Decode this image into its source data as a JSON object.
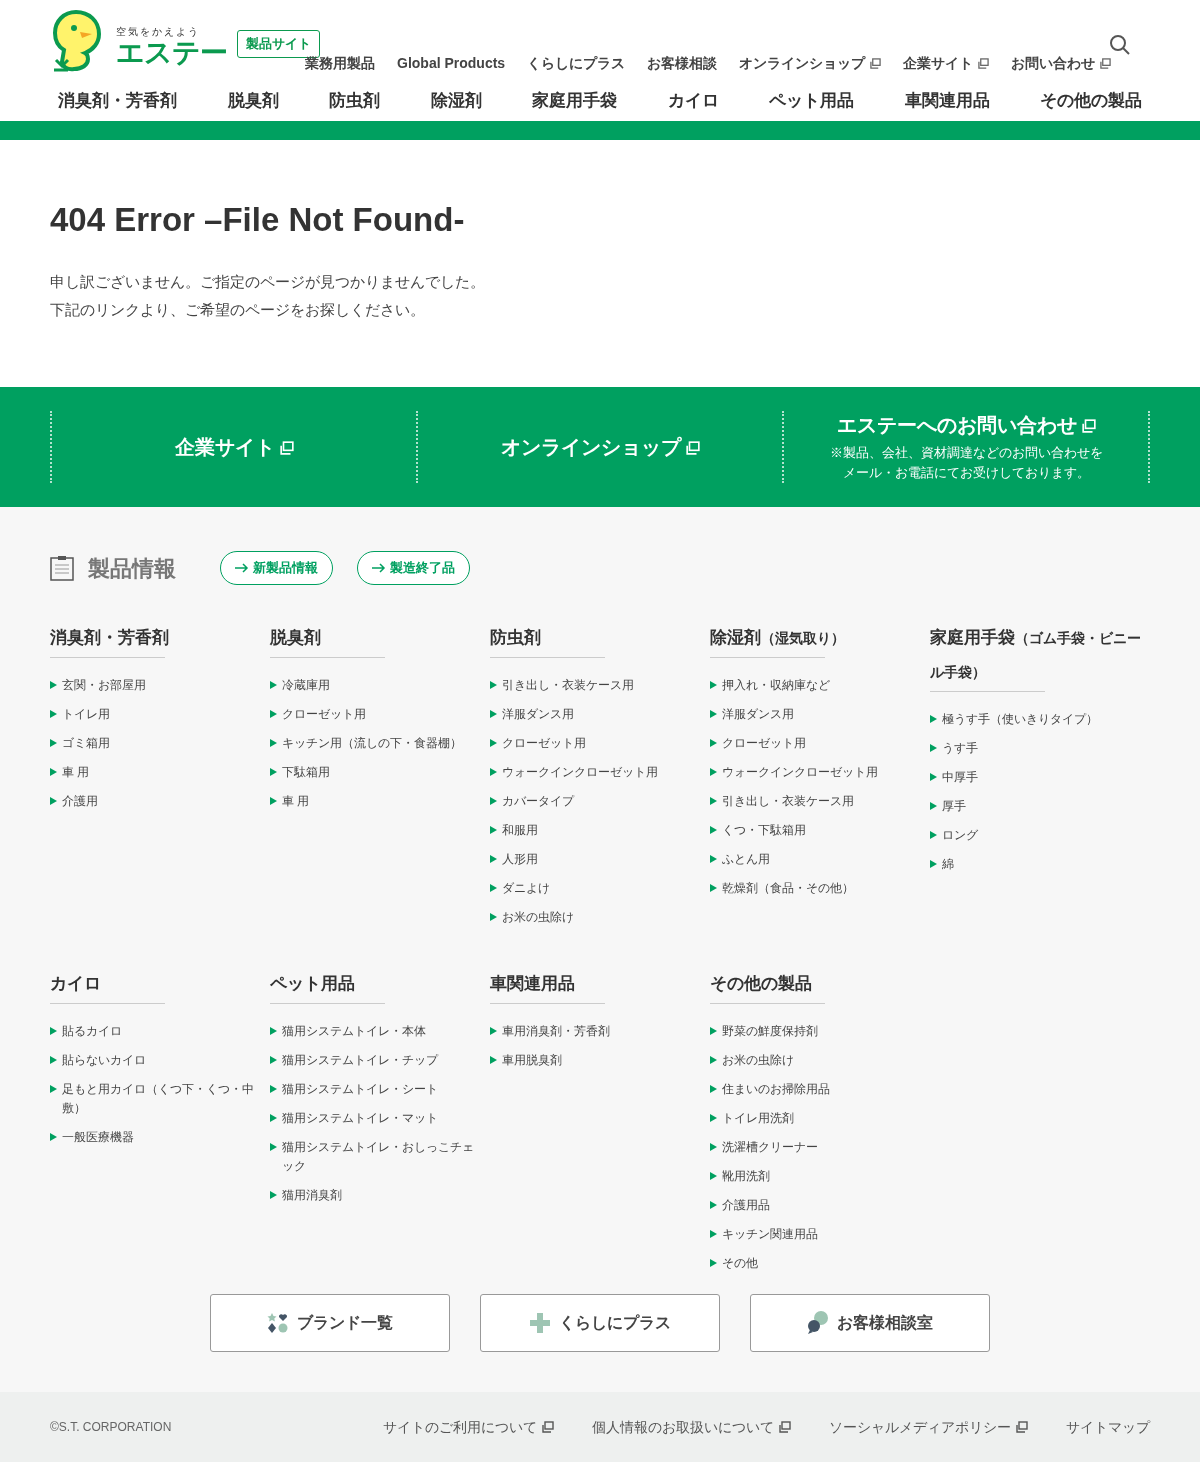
{
  "header": {
    "logo": {
      "tagline": "空気をかえよう",
      "name": "エステー"
    },
    "site_badge": "製品サイト",
    "top_nav": [
      {
        "label": "業務用製品",
        "external": false
      },
      {
        "label": "Global Products",
        "external": false
      },
      {
        "label": "くらしにプラス",
        "external": false
      },
      {
        "label": "お客様相談",
        "external": false
      },
      {
        "label": "オンラインショップ",
        "external": true
      },
      {
        "label": "企業サイト",
        "external": true
      },
      {
        "label": "お問い合わせ",
        "external": true
      }
    ],
    "product_nav": [
      "消臭剤・芳香剤",
      "脱臭剤",
      "防虫剤",
      "除湿剤",
      "家庭用手袋",
      "カイロ",
      "ペット用品",
      "車関連用品",
      "その他の製品"
    ]
  },
  "error": {
    "title": "404 Error –File Not Found-",
    "lines": [
      "申し訳ございません。ご指定のページが見つかりませんでした。",
      "下記のリンクより、ご希望のページをお探しください。"
    ]
  },
  "banner": [
    {
      "title": "企業サイト",
      "external": true
    },
    {
      "title": "オンラインショップ",
      "external": true
    },
    {
      "title": "エステーへのお問い合わせ",
      "external": true,
      "note_lines": [
        "※製品、会社、資材調達などのお問い合わせを",
        "メール・お電話にてお受けしております。"
      ]
    }
  ],
  "products": {
    "title": "製品情報",
    "buttons": [
      "新製品情報",
      "製造終了品"
    ],
    "categories": [
      {
        "title": "消臭剤・芳香剤",
        "items": [
          {
            "label": "玄関・お部屋用"
          },
          {
            "label": "トイレ用"
          },
          {
            "label": "ゴミ箱用"
          },
          {
            "label": "車 用"
          },
          {
            "label": "介護用"
          }
        ]
      },
      {
        "title": "脱臭剤",
        "items": [
          {
            "label": "冷蔵庫用"
          },
          {
            "label": "クローゼット用"
          },
          {
            "label": "キッチン用",
            "note": "（流しの下・食器棚）"
          },
          {
            "label": "下駄箱用"
          },
          {
            "label": "車 用"
          }
        ]
      },
      {
        "title": "防虫剤",
        "items": [
          {
            "label": "引き出し・衣装ケース用"
          },
          {
            "label": "洋服ダンス用"
          },
          {
            "label": "クローゼット用"
          },
          {
            "label": "ウォークインクローゼット用"
          },
          {
            "label": "カバータイプ"
          },
          {
            "label": "和服用"
          },
          {
            "label": "人形用"
          },
          {
            "label": "ダニよけ"
          },
          {
            "label": "お米の虫除け"
          }
        ]
      },
      {
        "title": "除湿剤",
        "note": "（湿気取り）",
        "items": [
          {
            "label": "押入れ・収納庫など"
          },
          {
            "label": "洋服ダンス用"
          },
          {
            "label": "クローゼット用"
          },
          {
            "label": "ウォークインクローゼット用"
          },
          {
            "label": "引き出し・衣装ケース用"
          },
          {
            "label": "くつ・下駄箱用"
          },
          {
            "label": "ふとん用"
          },
          {
            "label": "乾燥剤",
            "note": "（食品・その他）"
          }
        ]
      },
      {
        "title": "家庭用手袋",
        "note": "（ゴム手袋・ビニール手袋）",
        "items": [
          {
            "label": "極うす手",
            "note": "（使いきりタイプ）"
          },
          {
            "label": "うす手"
          },
          {
            "label": "中厚手"
          },
          {
            "label": "厚手"
          },
          {
            "label": "ロング"
          },
          {
            "label": "綿"
          }
        ]
      },
      {
        "title": "カイロ",
        "items": [
          {
            "label": "貼るカイロ"
          },
          {
            "label": "貼らないカイロ"
          },
          {
            "label": "足もと用カイロ",
            "note": "（くつ下・くつ・中敷）"
          },
          {
            "label": "一般医療機器"
          }
        ]
      },
      {
        "title": "ペット用品",
        "items": [
          {
            "label": "猫用システムトイレ・本体"
          },
          {
            "label": "猫用システムトイレ・チップ"
          },
          {
            "label": "猫用システムトイレ・シート"
          },
          {
            "label": "猫用システムトイレ・マット"
          },
          {
            "label": "猫用システムトイレ・おしっこチェック"
          },
          {
            "label": "猫用消臭剤"
          }
        ]
      },
      {
        "title": "車関連用品",
        "items": [
          {
            "label": "車用消臭剤・芳香剤"
          },
          {
            "label": "車用脱臭剤"
          }
        ]
      },
      {
        "title": "その他の製品",
        "items": [
          {
            "label": "野菜の鮮度保持剤"
          },
          {
            "label": "お米の虫除け"
          },
          {
            "label": "住まいのお掃除用品"
          },
          {
            "label": "トイレ用洗剤"
          },
          {
            "label": "洗濯槽クリーナー"
          },
          {
            "label": "靴用洗剤"
          },
          {
            "label": "介護用品"
          },
          {
            "label": "キッチン関連用品"
          },
          {
            "label": "その他"
          }
        ]
      }
    ]
  },
  "big_buttons": [
    {
      "kind": "brand",
      "label": "ブランド一覧"
    },
    {
      "kind": "plus",
      "label": "くらしにプラス"
    },
    {
      "kind": "chat",
      "label": "お客様相談室"
    }
  ],
  "footer": {
    "copyright": "©S.T. CORPORATION",
    "links": [
      {
        "label": "サイトのご利用について",
        "external": true
      },
      {
        "label": "個人情報のお取扱いについて",
        "external": true
      },
      {
        "label": "ソーシャルメディアポリシー",
        "external": true
      },
      {
        "label": "サイトマップ",
        "external": false
      }
    ]
  }
}
